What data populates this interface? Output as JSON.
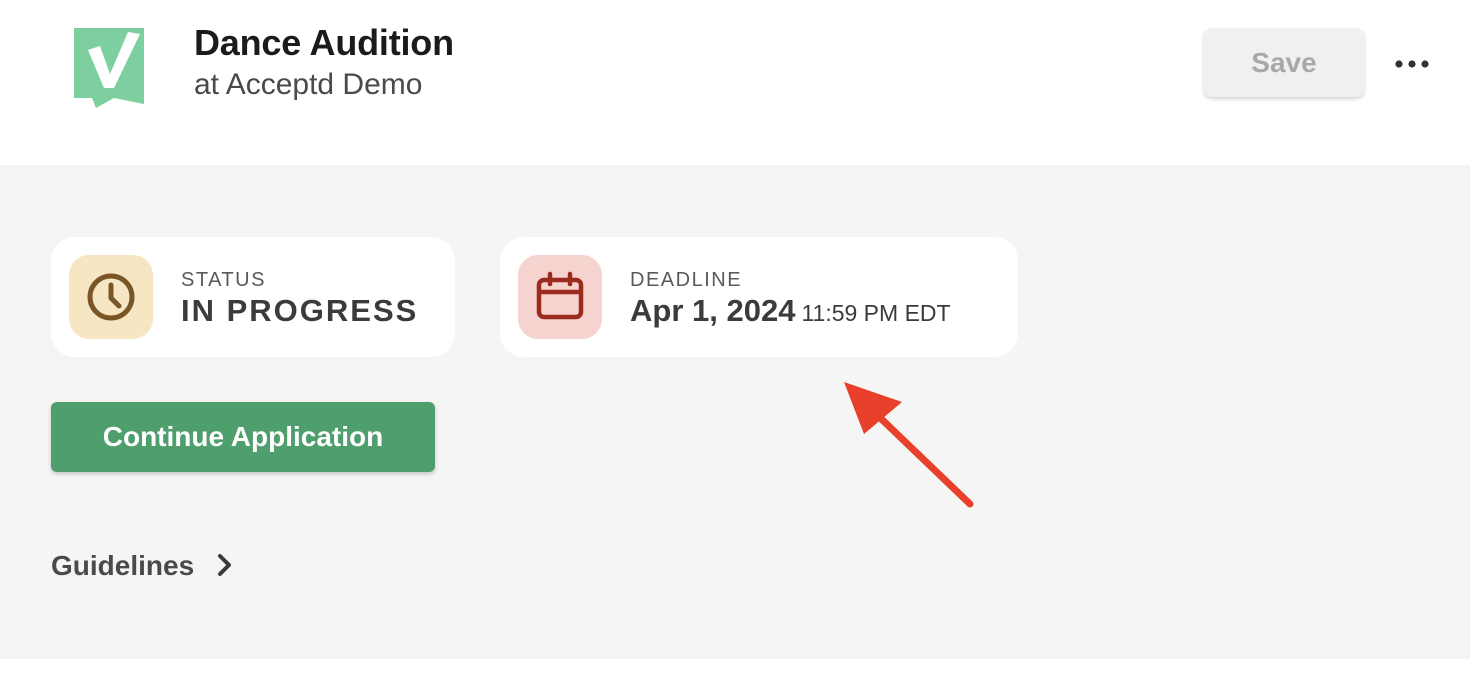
{
  "header": {
    "title": "Dance Audition",
    "subtitle": "at Acceptd Demo",
    "save_label": "Save",
    "logo_icon": "acceptd-checkmark-logo",
    "more_icon": "more-horizontal-icon"
  },
  "cards": {
    "status": {
      "label": "STATUS",
      "value": "IN PROGRESS",
      "icon": "clock-icon"
    },
    "deadline": {
      "label": "DEADLINE",
      "date": "Apr 1, 2024",
      "time": "11:59 PM EDT",
      "icon": "calendar-icon"
    }
  },
  "actions": {
    "continue_label": "Continue Application"
  },
  "guidelines": {
    "label": "Guidelines",
    "icon": "chevron-right-icon"
  },
  "colors": {
    "brand_green": "#4f9e6e",
    "logo_green": "#7dcfa0",
    "status_bg": "#f6e6c4",
    "status_icon": "#7a5525",
    "deadline_bg": "#f5d3cf",
    "deadline_icon": "#9c2b1f",
    "annotation_arrow": "#e8402a"
  }
}
